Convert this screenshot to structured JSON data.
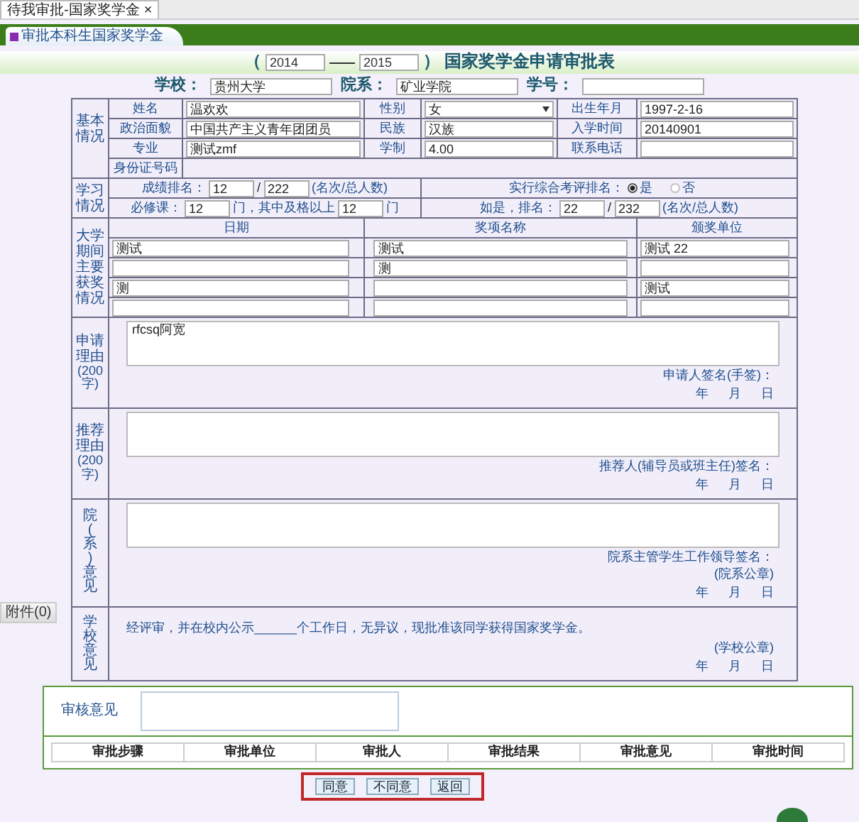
{
  "browser_tab": {
    "label": "待我审批-国家奖学金",
    "close": "×"
  },
  "header_tab": {
    "label": "审批本科生国家奖学金"
  },
  "title": {
    "paren_open": "（",
    "year_from": "2014",
    "year_to": "2015",
    "paren_close": "）",
    "text": "国家奖学金申请审批表"
  },
  "school_line": [
    {
      "label": "学校：",
      "value": "贵州大学"
    },
    {
      "label": "院系：",
      "value": "矿业学院"
    },
    {
      "label": "学号："
    }
  ],
  "basic": {
    "heading": "基本情况",
    "rows": [
      [
        {
          "label": "姓名",
          "value": "温欢欢",
          "kind": "text"
        },
        {
          "label": "性别",
          "value": "女",
          "kind": "select"
        },
        {
          "label": "出生年月",
          "value": "1997-2-16",
          "kind": "text"
        }
      ],
      [
        {
          "label": "政治面貌",
          "value": "中国共产主义青年团团员",
          "kind": "text"
        },
        {
          "label": "民族",
          "value": "汉族",
          "kind": "text"
        },
        {
          "label": "入学时间",
          "value": "20140901",
          "kind": "text"
        }
      ],
      [
        {
          "label": "专业",
          "value": "测试zmf",
          "kind": "text"
        },
        {
          "label": "学制",
          "value": "4.00",
          "kind": "text"
        },
        {
          "label": "联系电话",
          "kind": "text"
        }
      ]
    ],
    "id_label": "身份证号码"
  },
  "study": {
    "heading": "学习情况",
    "rank": {
      "label": "成绩排名：",
      "rank": "12",
      "sep": "/",
      "total": "222",
      "note": "(名次/总人数)"
    },
    "comprehensive": {
      "label": "实行综合考评排名：",
      "options": [
        {
          "label": "是",
          "selected": true
        },
        {
          "label": "否",
          "selected": false
        }
      ]
    },
    "courses": {
      "label": "必修课：",
      "count": "12",
      "unit": "门，其中及格以上",
      "passed": "12",
      "unit2": "门"
    },
    "if_yes": {
      "label": "如是，排名：",
      "rank": "22",
      "sep": "/",
      "total": "232",
      "note": "(名次/总人数)"
    }
  },
  "awards": {
    "heading": "大学期间主要获奖情况",
    "columns": [
      "日期",
      "奖项名称",
      "颁奖单位"
    ],
    "rows": [
      [
        "测试",
        "测试",
        "测试  22"
      ],
      [
        null,
        "测",
        null
      ],
      [
        "测",
        null,
        "测试"
      ],
      [
        null,
        null,
        null
      ]
    ]
  },
  "sections": [
    {
      "kind": "textarea",
      "heading": "申请理由",
      "sub": "(200字)",
      "text": "rfcsq阿宽",
      "signature": "申请人签名(手签)：",
      "date": [
        "年",
        "月",
        "日"
      ]
    },
    {
      "kind": "textarea",
      "heading": "推荐理由",
      "sub": "(200字)",
      "signature": "推荐人(辅导员或班主任)签名：",
      "date": [
        "年",
        "月",
        "日"
      ]
    },
    {
      "kind": "textarea",
      "heading": "院(系)意见",
      "signature": "院系主管学生工作领导签名：",
      "seal": "(院系公章)",
      "date": [
        "年",
        "月",
        "日"
      ]
    },
    {
      "kind": "statement",
      "heading": "学校意见",
      "statement": "经评审，并在校内公示______个工作日，无异议，现批准该同学获得国家奖学金。",
      "seal": "(学校公章)",
      "date": [
        "年",
        "月",
        "日"
      ]
    }
  ],
  "attachment_tab": {
    "label": "附件(0)"
  },
  "review": {
    "label": "审核意见",
    "columns": [
      "审批步骤",
      "审批单位",
      "审批人",
      "审批结果",
      "审批意见",
      "审批时间"
    ]
  },
  "buttons": [
    "同意",
    "不同意",
    "返回"
  ]
}
